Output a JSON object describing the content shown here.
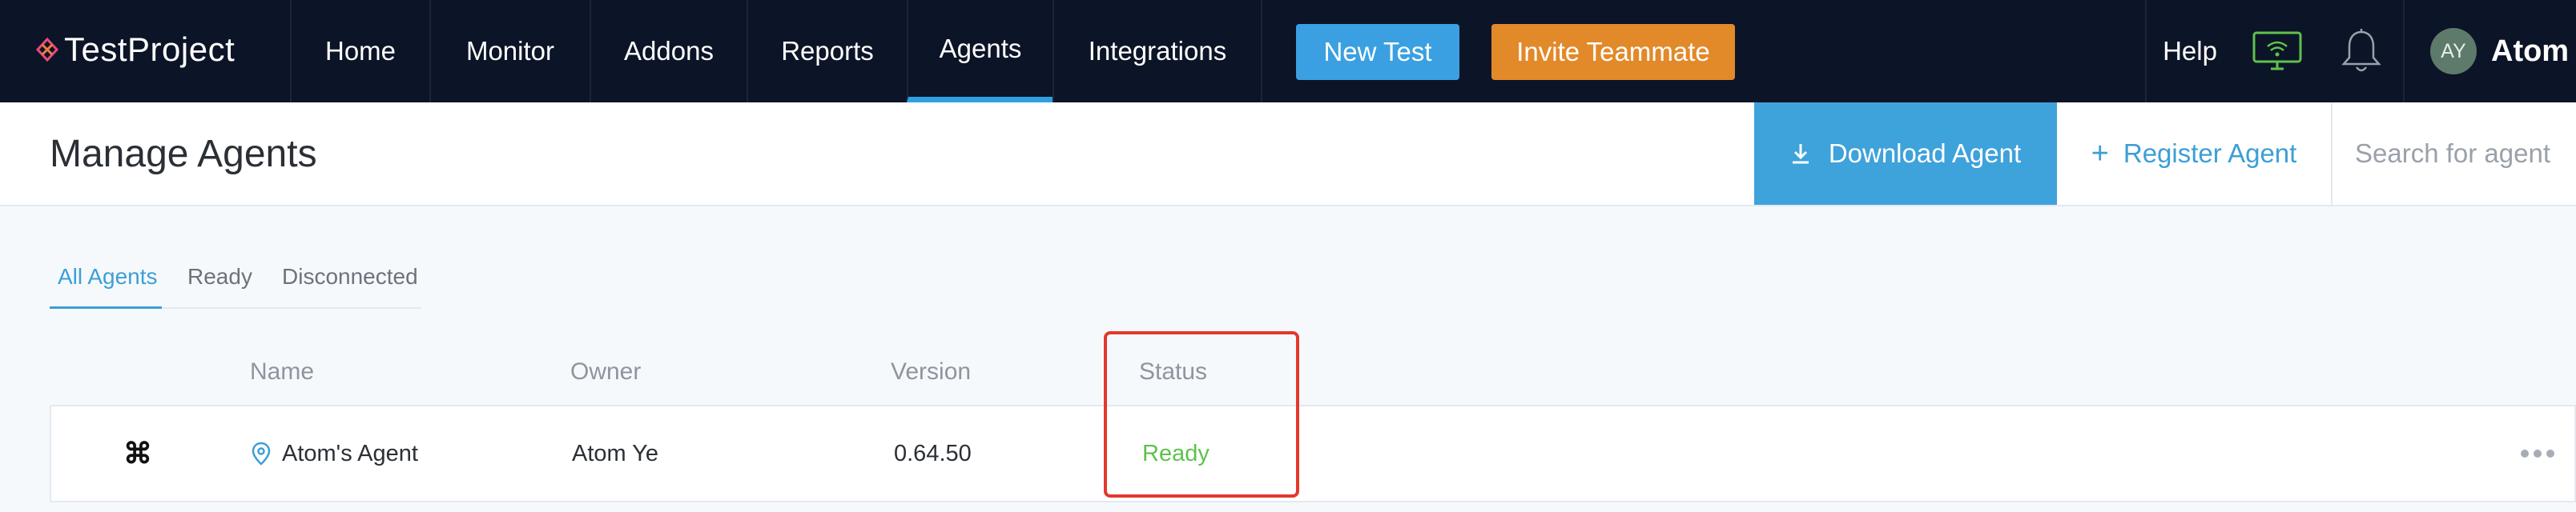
{
  "brand": {
    "name_bold": "Test",
    "name_light": "Project"
  },
  "nav": {
    "tabs": [
      {
        "label": "Home"
      },
      {
        "label": "Monitor"
      },
      {
        "label": "Addons"
      },
      {
        "label": "Reports"
      },
      {
        "label": "Agents",
        "active": true
      },
      {
        "label": "Integrations"
      }
    ],
    "new_test_label": "New Test",
    "invite_label": "Invite Teammate",
    "help_label": "Help",
    "monitor_icon": "monitor-wifi-icon",
    "bell_icon": "bell-icon",
    "user": {
      "initials": "AY",
      "name": "Atom"
    }
  },
  "header": {
    "title": "Manage Agents",
    "download_label": "Download Agent",
    "register_label": "Register Agent",
    "search_placeholder": "Search for agent"
  },
  "filters": [
    {
      "label": "All Agents",
      "active": true
    },
    {
      "label": "Ready"
    },
    {
      "label": "Disconnected"
    }
  ],
  "table": {
    "columns": [
      "Name",
      "Owner",
      "Version",
      "Status"
    ],
    "rows": [
      {
        "os_icon": "⌘",
        "name": "Atom's Agent",
        "owner": "Atom Ye",
        "version": "0.64.50",
        "status": "Ready"
      }
    ]
  },
  "colors": {
    "navbar_bg": "#0c1427",
    "accent_blue": "#3ea2db",
    "invite_orange": "#e2892a",
    "status_ready": "#5ec24c",
    "highlight_red": "#e4372c"
  }
}
